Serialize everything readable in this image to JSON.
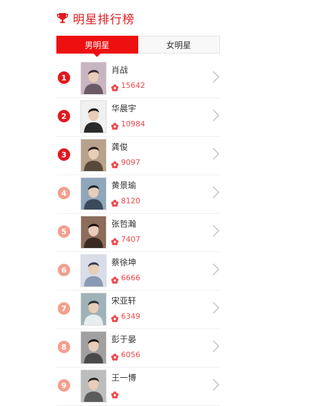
{
  "header": {
    "title": "明星排行榜",
    "accent_color": "#e0191f",
    "icon": "trophy-icon"
  },
  "tabs": [
    {
      "label": "男明星",
      "active": true
    },
    {
      "label": "女明星",
      "active": false
    }
  ],
  "rank_colors": {
    "top": "#e0191f",
    "rest": "#f2a08f"
  },
  "stars": [
    {
      "rank": "1",
      "name": "肖战",
      "score": "15642",
      "icon": "flower-icon"
    },
    {
      "rank": "2",
      "name": "华晨宇",
      "score": "10984",
      "icon": "flower-icon"
    },
    {
      "rank": "3",
      "name": "龚俊",
      "score": "9097",
      "icon": "flower-icon"
    },
    {
      "rank": "4",
      "name": "黄景瑜",
      "score": "8120",
      "icon": "flower-icon"
    },
    {
      "rank": "5",
      "name": "张哲瀚",
      "score": "7407",
      "icon": "flower-icon"
    },
    {
      "rank": "6",
      "name": "蔡徐坤",
      "score": "6666",
      "icon": "flower-icon"
    },
    {
      "rank": "7",
      "name": "宋亚轩",
      "score": "6349",
      "icon": "flower-icon"
    },
    {
      "rank": "8",
      "name": "彭于晏",
      "score": "6056",
      "icon": "flower-icon"
    },
    {
      "rank": "9",
      "name": "王一博",
      "score": "",
      "icon": "flower-icon"
    }
  ]
}
